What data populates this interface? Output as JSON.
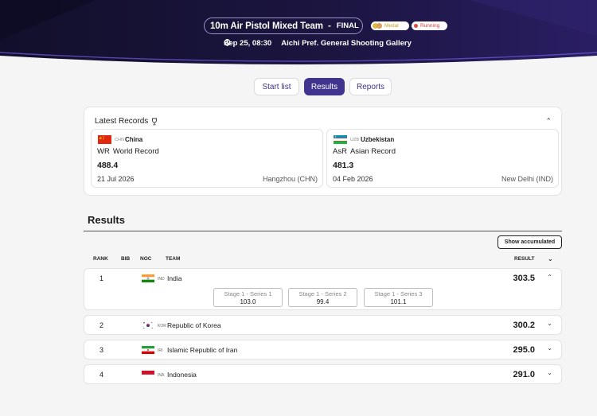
{
  "event": {
    "title": "10m Air Pistol Mixed Team",
    "separator": "-",
    "phase": "FINAL",
    "badges": {
      "medal": "Medal",
      "running": "Running"
    },
    "datetime": "Sep 25, 08:30",
    "venue": "Aichi Pref. General Shooting Gallery"
  },
  "tabs": {
    "start_list": "Start list",
    "results": "Results",
    "reports": "Reports",
    "active": "Results"
  },
  "records": {
    "title": "Latest Records",
    "items": [
      {
        "noc": "CHN",
        "country": "China",
        "code": "WR",
        "label": "World Record",
        "value": "488.4",
        "date": "21 Jul 2026",
        "place": "Hangzhou (CHN)"
      },
      {
        "noc": "UZB",
        "country": "Uzbekistan",
        "code": "AsR",
        "label": "Asian Record",
        "value": "481.3",
        "date": "04 Feb 2026",
        "place": "New Delhi (IND)"
      }
    ]
  },
  "results": {
    "heading": "Results",
    "accumulated_label": "Show accumulated",
    "columns": {
      "rank": "RANK",
      "bib": "BIB",
      "noc": "NOC",
      "team": "TEAM",
      "result": "RESULT"
    },
    "rows": [
      {
        "rank": "1",
        "noc": "IND",
        "team": "India",
        "result": "303.5",
        "expanded": true,
        "series": [
          {
            "label": "Stage 1 - Series 1",
            "value": "103.0"
          },
          {
            "label": "Stage 1 - Series 2",
            "value": "99.4"
          },
          {
            "label": "Stage 1 - Series 3",
            "value": "101.1"
          }
        ]
      },
      {
        "rank": "2",
        "noc": "KOR",
        "team": "Republic of Korea",
        "result": "300.2",
        "expanded": false
      },
      {
        "rank": "3",
        "noc": "IRI",
        "team": "Islamic Republic of Iran",
        "result": "295.0",
        "expanded": false
      },
      {
        "rank": "4",
        "noc": "INA",
        "team": "Indonesia",
        "result": "291.0",
        "expanded": false
      }
    ]
  },
  "colors": {
    "header_bg": "#171238",
    "accent": "#40348e",
    "page_bg": "#f5f5f5"
  },
  "icons": {
    "clock": "clock-icon",
    "location": "location-pin-icon",
    "trophy": "trophy-icon",
    "chevron_up": "chevron-up-icon",
    "chevron_down": "chevron-down-icon"
  }
}
